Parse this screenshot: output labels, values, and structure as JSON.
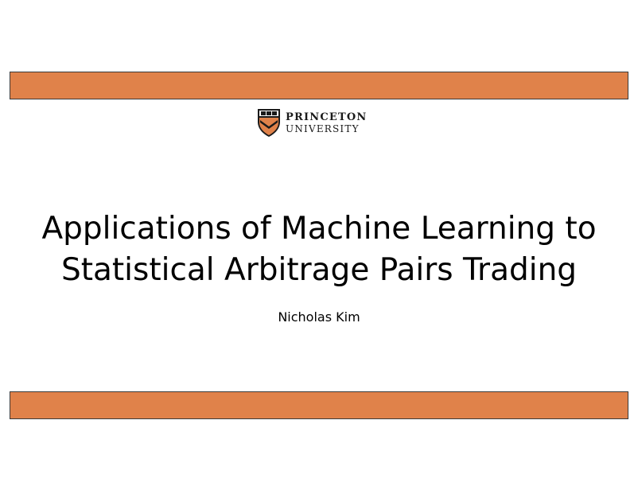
{
  "slide": {
    "logo": {
      "line1": "PRINCETON",
      "line2": "UNIVERSITY",
      "icon": "princeton-shield-icon"
    },
    "title_line1": "Applications of Machine Learning to",
    "title_line2": "Statistical Arbitrage Pairs Trading",
    "author": "Nicholas Kim"
  },
  "colors": {
    "band": "#e0824a",
    "band_border": "#3a3a3a",
    "shield_dark": "#1a1a1a",
    "shield_orange": "#e0824a"
  }
}
